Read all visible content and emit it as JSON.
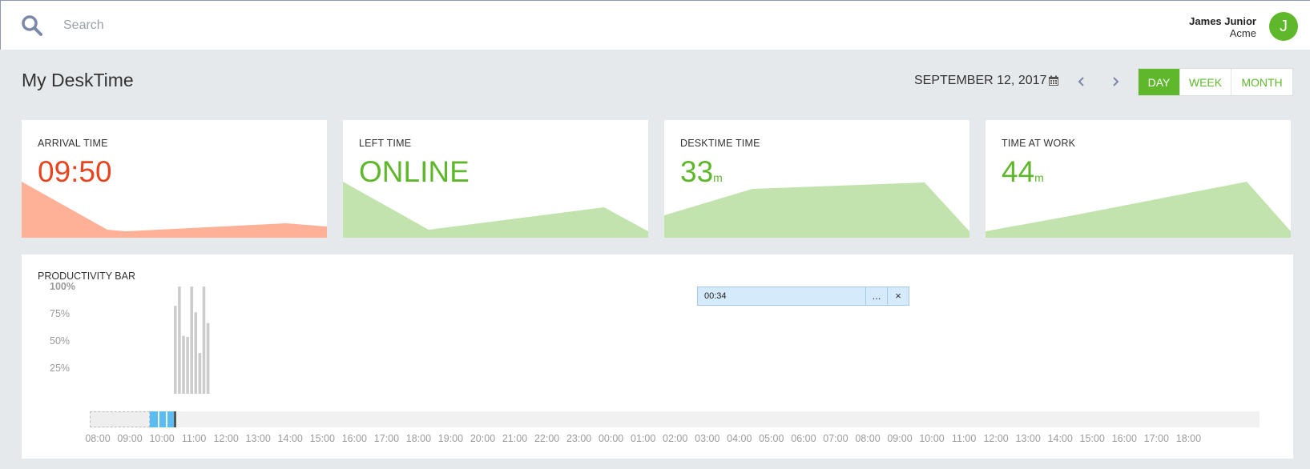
{
  "search": {
    "placeholder": "Search"
  },
  "user": {
    "name": "James Junior",
    "company": "Acme",
    "initial": "J"
  },
  "page": {
    "title": "My DeskTime"
  },
  "date": {
    "label": "SEPTEMBER 12, 2017"
  },
  "view_tabs": [
    {
      "label": "DAY",
      "active": true
    },
    {
      "label": "WEEK",
      "active": false
    },
    {
      "label": "MONTH",
      "active": false
    }
  ],
  "cards": [
    {
      "label": "ARRIVAL TIME",
      "value": "09:50",
      "unit": "",
      "color": "#e8451e",
      "fill": "#ffb197"
    },
    {
      "label": "LEFT TIME",
      "value": "ONLINE",
      "unit": "",
      "color": "#5fb82c",
      "fill": "#c2e3ad"
    },
    {
      "label": "DESKTIME TIME",
      "value": "33",
      "unit": "m",
      "color": "#5fb82c",
      "fill": "#c2e3ad"
    },
    {
      "label": "TIME AT WORK",
      "value": "44",
      "unit": "m",
      "color": "#5fb82c",
      "fill": "#c2e3ad"
    }
  ],
  "productivity": {
    "label": "PRODUCTIVITY BAR",
    "y_labels": [
      "100%",
      "75%",
      "50%",
      "25%"
    ],
    "x_ticks": [
      "08:00",
      "09:00",
      "10:00",
      "11:00",
      "12:00",
      "13:00",
      "14:00",
      "15:00",
      "16:00",
      "17:00",
      "18:00",
      "19:00",
      "20:00",
      "21:00",
      "22:00",
      "23:00",
      "00:00",
      "01:00",
      "02:00",
      "03:00",
      "04:00",
      "05:00",
      "06:00",
      "07:00",
      "08:00",
      "09:00",
      "10:00",
      "11:00",
      "12:00",
      "13:00",
      "14:00",
      "15:00",
      "16:00",
      "17:00",
      "18:00"
    ],
    "tooltip_time": "00:34",
    "tooltip_min": "...",
    "tooltip_close": "×"
  },
  "chart_data": {
    "type": "bar",
    "title": "PRODUCTIVITY BAR",
    "x_range": [
      "08:00",
      "18:00 (+1 day)"
    ],
    "ylim": [
      0,
      100
    ],
    "y_ticks": [
      "25%",
      "50%",
      "75%",
      "100%"
    ],
    "bar_start_time": "10:20",
    "bar_interval_minutes": 5,
    "values": [
      82,
      100,
      54,
      53,
      100,
      76,
      38,
      100,
      66
    ]
  },
  "colors": {
    "accent_green": "#5fb82c",
    "accent_red": "#e8451e",
    "activity_blue": "#5bbcf2",
    "bar_grey": "#cccccc"
  }
}
